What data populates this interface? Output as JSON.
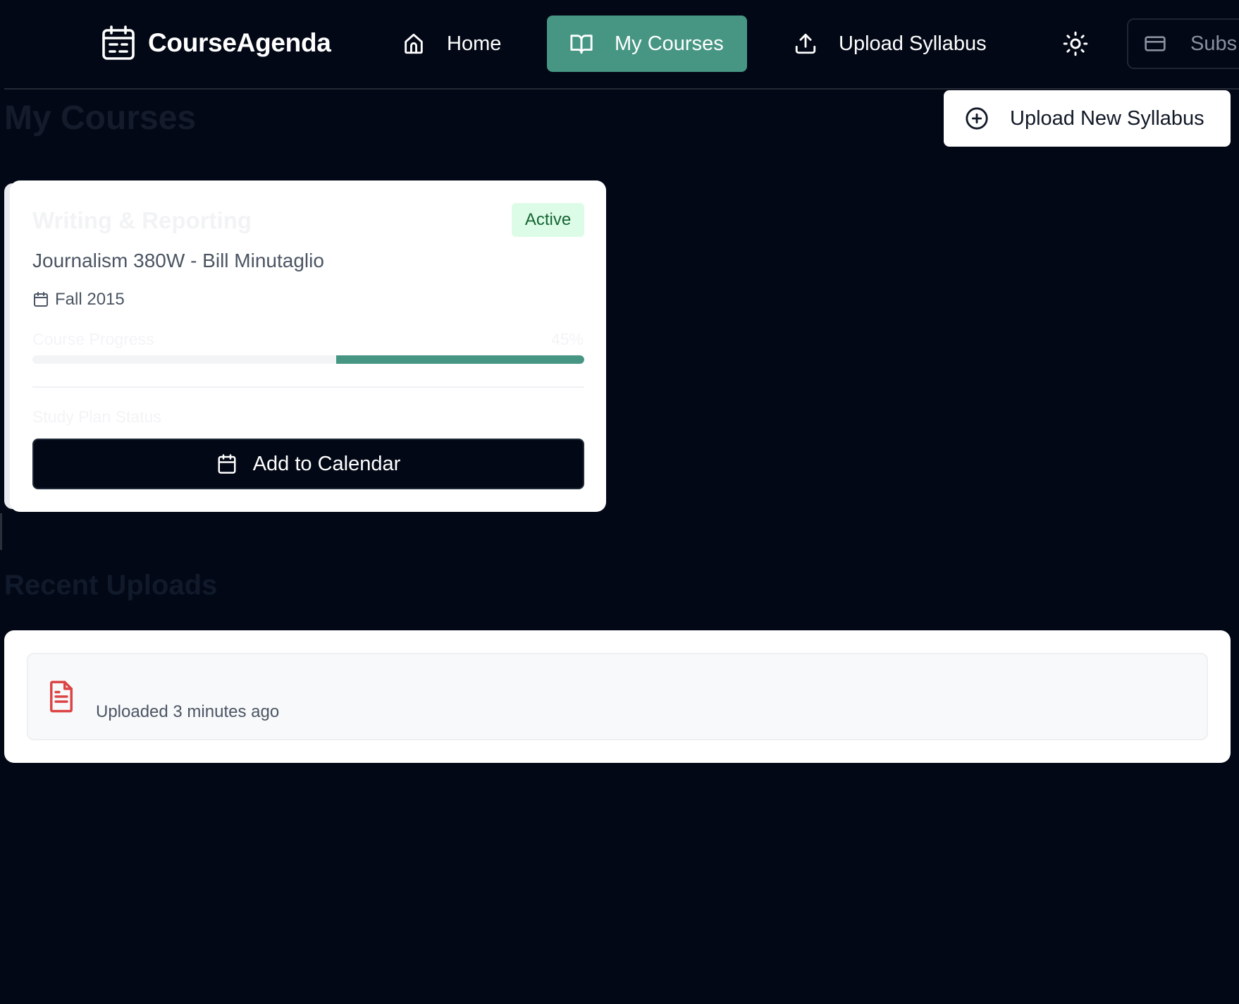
{
  "app": {
    "name": "CourseAgenda"
  },
  "nav": {
    "items": [
      {
        "label": "Home",
        "icon": "home-icon"
      },
      {
        "label": "My Courses",
        "icon": "book-open-icon",
        "active": true
      },
      {
        "label": "Upload Syllabus",
        "icon": "upload-icon"
      }
    ],
    "theme_toggle_icon": "sun-icon",
    "subscription_label": "Subs",
    "subscription_icon": "credit-card-icon"
  },
  "page": {
    "title": "My Courses",
    "upload_button_label": "Upload New Syllabus"
  },
  "course": {
    "title": "Writing & Reporting",
    "subtitle": "Journalism 380W - Bill Minutaglio",
    "term": "Fall 2015",
    "status": "Active",
    "progress_label": "Course Progress",
    "progress_text": "45%",
    "progress_value": 0.45,
    "study_plan_label": "Study Plan Status",
    "calendar_button_label": "Add to Calendar"
  },
  "recent": {
    "title": "Recent Uploads",
    "items": [
      {
        "time": "Uploaded 3 minutes ago",
        "icon": "file-text-icon"
      }
    ]
  },
  "colors": {
    "background": "#030816",
    "accent": "#469683",
    "active_badge_bg": "#dcfce7",
    "active_badge_text": "#166534",
    "file_icon": "#dc4545"
  }
}
